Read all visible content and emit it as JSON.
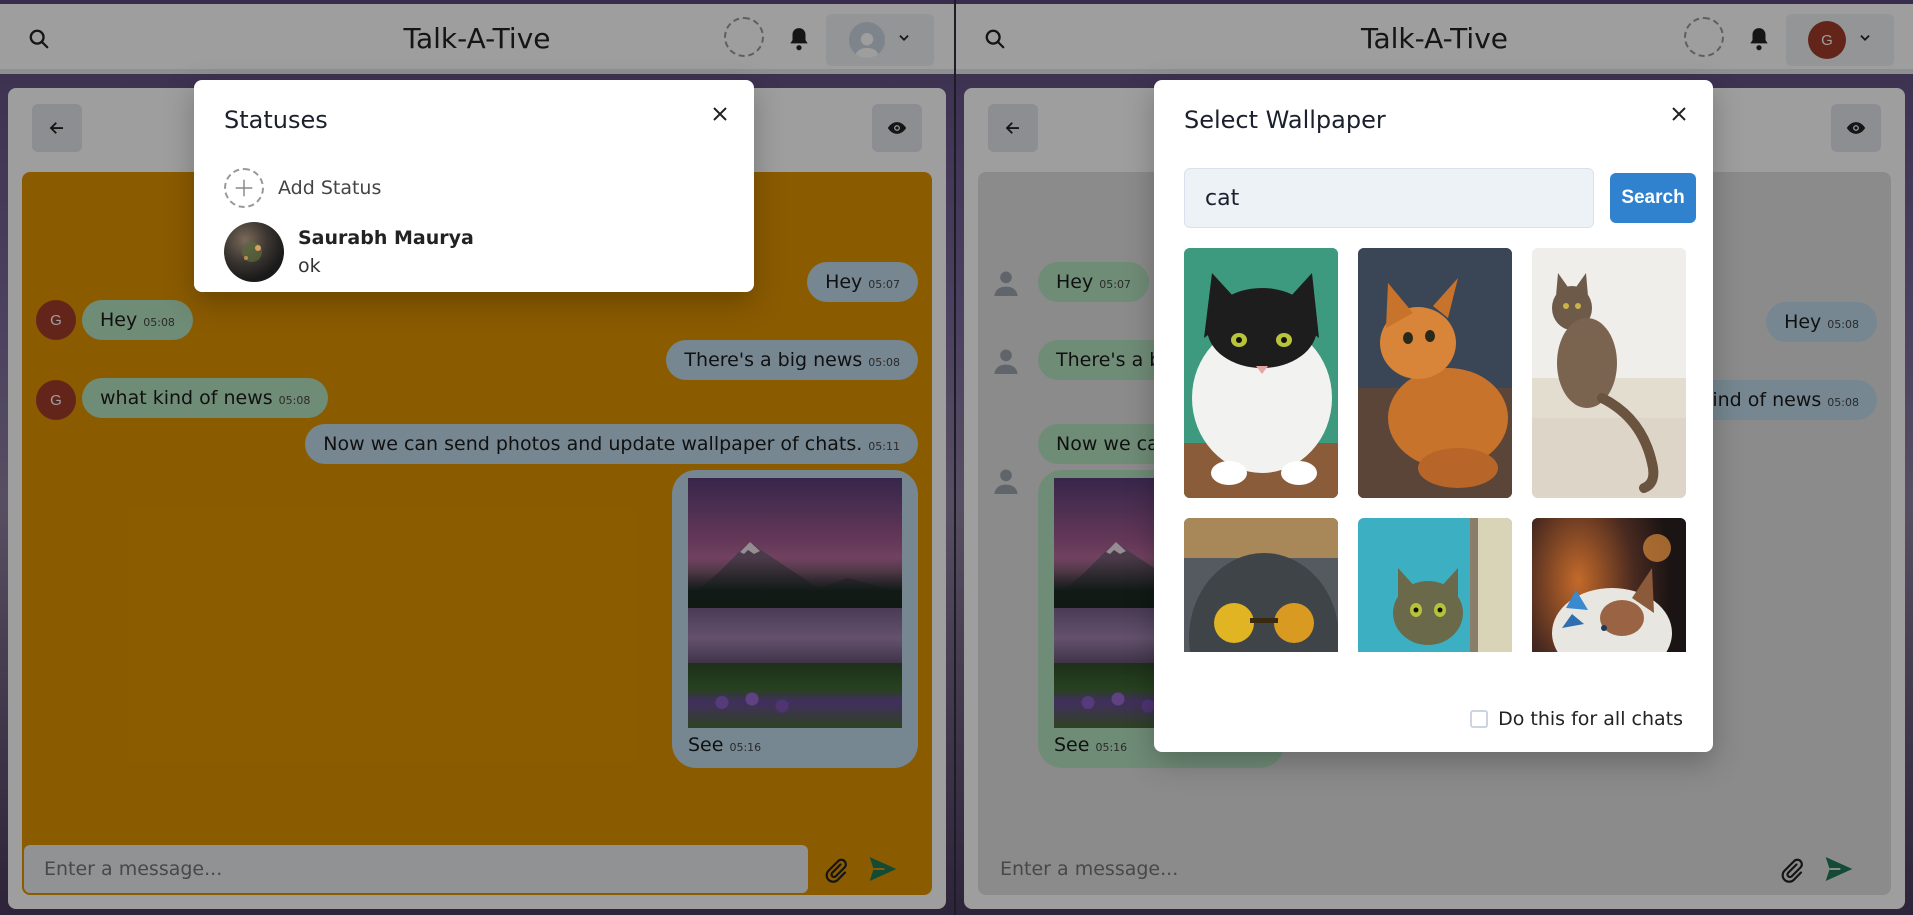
{
  "app": {
    "title": "Talk-A-Tive"
  },
  "left_panel": {
    "profile_initial": "G",
    "modal": {
      "title": "Statuses",
      "add_status_label": "Add Status",
      "statuses": [
        {
          "name": "Saurabh Maurya",
          "text": "ok"
        }
      ]
    }
  },
  "right_panel": {
    "profile_initial": "G",
    "modal": {
      "title": "Select Wallpaper",
      "search_value": "cat",
      "search_button": "Search",
      "apply_all_label": "Do this for all chats"
    }
  },
  "messages": [
    {
      "sender": "me",
      "text": "Hey",
      "time": "05:07"
    },
    {
      "sender": "G",
      "text": "Hey",
      "time": "05:08"
    },
    {
      "sender": "me",
      "text": "There's a big news",
      "time": "05:08"
    },
    {
      "sender": "G",
      "text": "what kind of news",
      "time": "05:08"
    },
    {
      "sender": "me",
      "text": "Now we can send photos and update wallpaper of chats.",
      "time": "05:11"
    },
    {
      "sender": "me",
      "text": "See",
      "time": "05:16",
      "image": "mountain-lake"
    }
  ],
  "right_messages_visible": {
    "m1": "Hey",
    "m1_time": "05:07",
    "m2": "There's a b",
    "m3": "Hey",
    "m3_time": "05:08",
    "m4": "ind of news",
    "m4_time": "05:08",
    "m5": "Now we ca",
    "m6": "See",
    "m6_time": "05:16"
  },
  "composer": {
    "placeholder": "Enter a message..."
  },
  "colors": {
    "left_chat_bg": "#e19400",
    "sent_bubble": "#bedaeb",
    "recv_bubble": "#b4e3c1",
    "accent": "#3182ce",
    "send_icon": "#1f7a5a"
  }
}
